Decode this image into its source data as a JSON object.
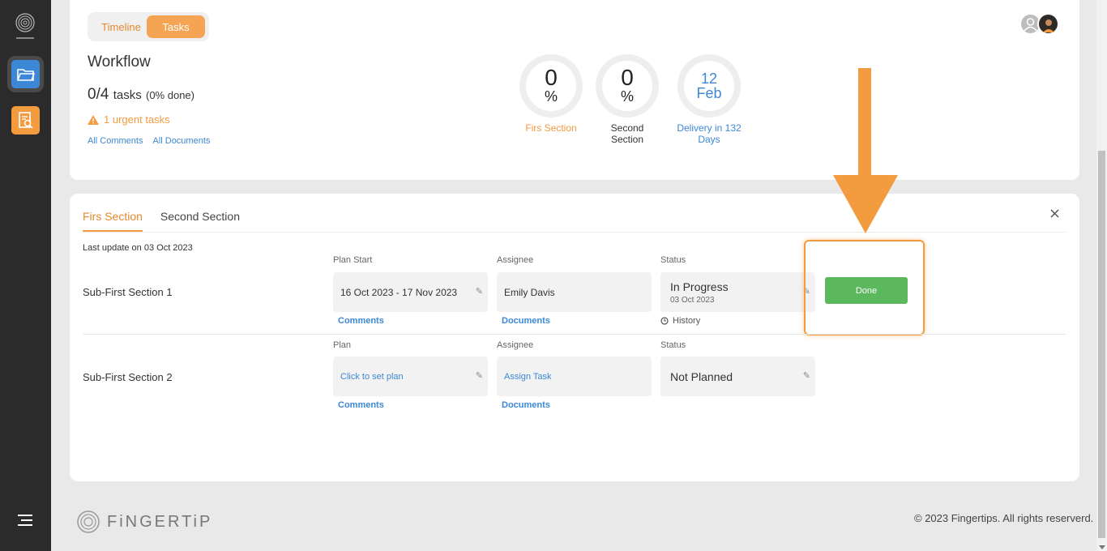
{
  "sidebar": {
    "logo_text": "FiNGERTiP",
    "items": [
      {
        "icon": "folder-icon"
      },
      {
        "icon": "report-search-icon"
      }
    ],
    "menu_icon": "menu-icon"
  },
  "header": {
    "toggle": {
      "timeline": "Timeline",
      "tasks": "Tasks"
    },
    "title": "Workflow",
    "tasks_done": "0/4",
    "tasks_label": "tasks",
    "tasks_pct": "(0% done)",
    "urgent": "1 urgent tasks",
    "links": {
      "comments": "All Comments",
      "documents": "All Documents"
    },
    "stats": [
      {
        "value": "0",
        "unit": "%",
        "caption": "Firs Section"
      },
      {
        "value": "0",
        "unit": "%",
        "caption": "Second Section"
      },
      {
        "day": "12",
        "month": "Feb",
        "caption": "Delivery in 132 Days"
      }
    ]
  },
  "main": {
    "tabs": [
      {
        "label": "Firs Section",
        "active": true
      },
      {
        "label": "Second Section",
        "active": false
      }
    ],
    "last_update": "Last update on 03 Oct 2023",
    "rows": [
      {
        "name": "Sub-First Section 1",
        "plan_label": "Plan Start",
        "plan_value": "16 Oct 2023 - 17 Nov 2023",
        "assignee_label": "Assignee",
        "assignee_value": "Emily Davis",
        "status_label": "Status",
        "status_value": "In Progress",
        "status_date": "03 Oct 2023",
        "comments": "Comments",
        "documents": "Documents",
        "history": "History",
        "done_button": "Done"
      },
      {
        "name": "Sub-First Section 2",
        "plan_label": "Plan",
        "plan_value": "Click to set plan",
        "assignee_label": "Assignee",
        "assignee_value": "Assign Task",
        "status_label": "Status",
        "status_value": "Not Planned",
        "comments": "Comments",
        "documents": "Documents"
      }
    ]
  },
  "footer": {
    "logo_text": "FiNGERTiP",
    "copyright": "© 2023 Fingertips. All rights reserverd."
  },
  "colors": {
    "accent_orange": "#f29b3f",
    "accent_blue": "#3d88d6",
    "done_green": "#5cb85c",
    "sidebar_bg": "#2b2b2b"
  }
}
